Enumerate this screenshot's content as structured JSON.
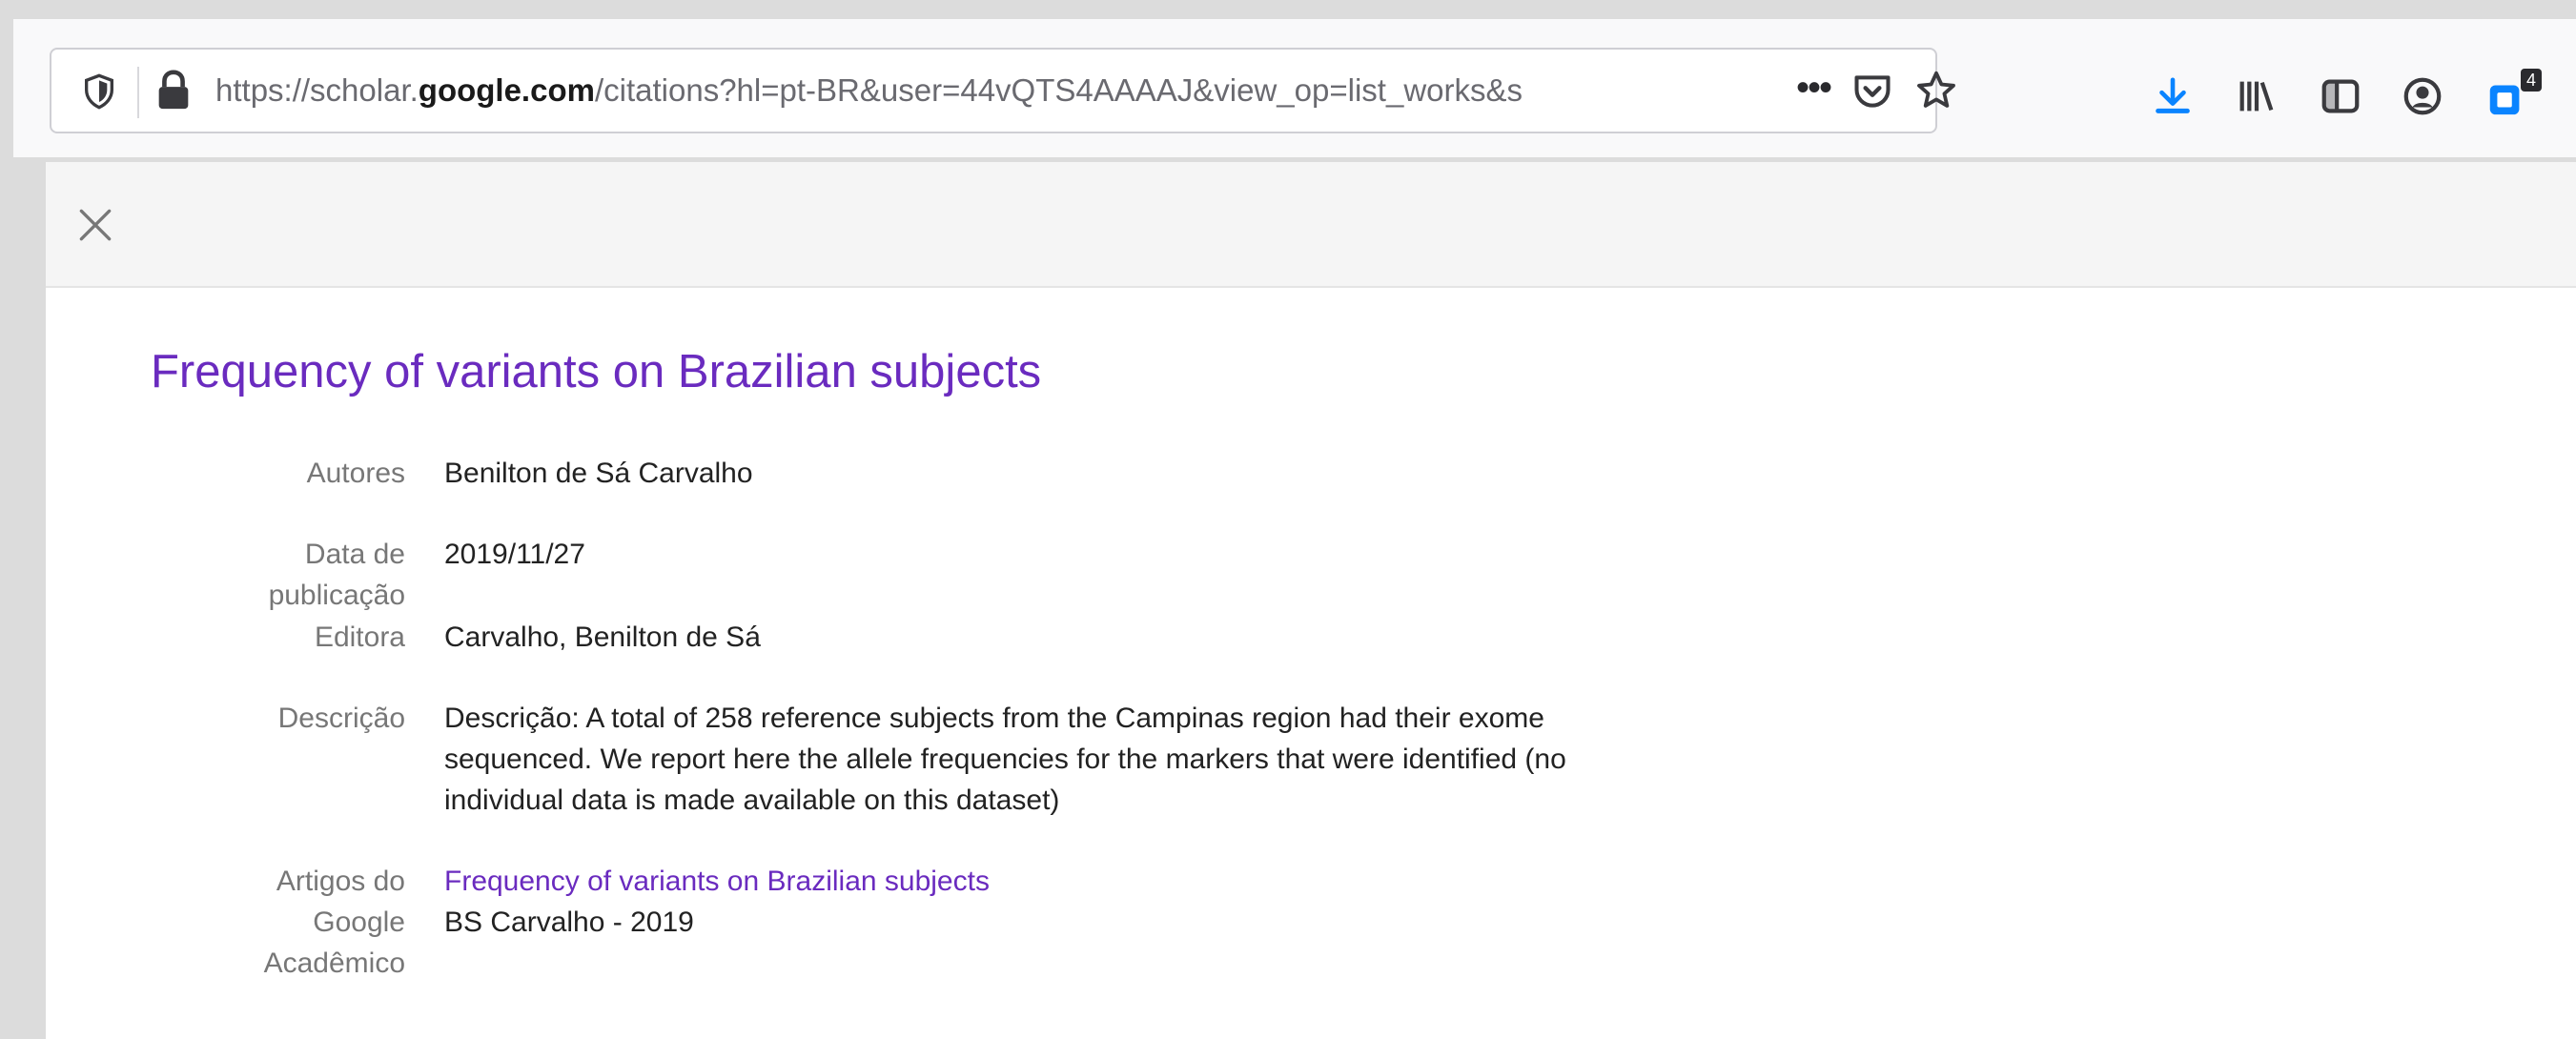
{
  "browser": {
    "url_prefix": "https://scholar.",
    "url_domain": "google.com",
    "url_rest": "/citations?hl=pt-BR&user=44vQTS4AAAAJ&view_op=list_works&s",
    "more_label": "•••",
    "extensions_badge": "4",
    "accent_color": "#0a84ff"
  },
  "icons": {
    "shield": "tracking-protection-icon",
    "lock": "lock-icon",
    "pocket": "pocket-icon",
    "star": "bookmark-star-icon",
    "download": "download-icon",
    "library": "library-icon",
    "sidebar": "sidebar-icon",
    "account": "account-icon",
    "extension": "extension-icon",
    "close": "close-icon"
  },
  "article": {
    "title": "Frequency of variants on Brazilian subjects",
    "fields": [
      {
        "label": "Autores",
        "value": "Benilton de Sá Carvalho"
      },
      {
        "label_line1": "Data de",
        "label_line2": "publicação",
        "value": "2019/11/27"
      },
      {
        "label": "Editora",
        "value": "Carvalho, Benilton de Sá"
      },
      {
        "label": "Descrição",
        "value_lines": [
          "Descrição: A total of 258 reference subjects from the Campinas region had their exome",
          "sequenced. We report here the allele frequencies for the markers that were identified (no",
          "individual data is made available on this dataset)"
        ]
      },
      {
        "label_lines": [
          "Artigos do",
          "Google",
          "Acadêmico"
        ],
        "link": "Frequency of variants on Brazilian subjects",
        "citation": "BS Carvalho - 2019"
      }
    ]
  },
  "colors": {
    "title_purple": "#6a2bbf",
    "label_gray": "#777777",
    "text_dark": "#222222"
  }
}
